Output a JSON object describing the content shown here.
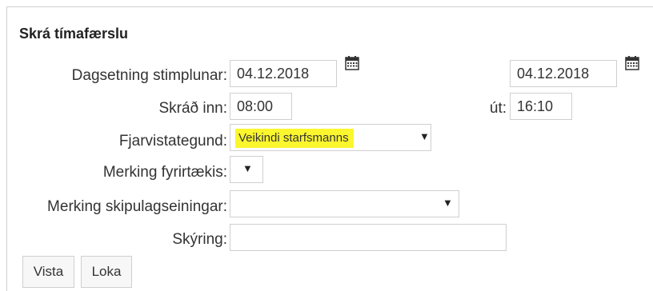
{
  "form": {
    "title": "Skrá tímafærslu",
    "date_label": "Dagsetning stimplunar:",
    "date_from": "04.12.2018",
    "date_to": "04.12.2018",
    "in_label": "Skráð inn:",
    "time_in": "08:00",
    "out_label": "út:",
    "time_out": "16:10",
    "absence_label": "Fjarvistategund:",
    "absence_value": "Veikindi starfsmanns",
    "company_label": "Merking fyrirtækis:",
    "company_value": "",
    "unit_label": "Merking skipulagseiningar:",
    "unit_value": "",
    "note_label": "Skýring:",
    "note_value": "",
    "highlight_color": "#fbf62e",
    "dropdown_arrow": "▼",
    "calendar_icon": "calendar-icon"
  },
  "buttons": {
    "save": "Vista",
    "close": "Loka"
  }
}
